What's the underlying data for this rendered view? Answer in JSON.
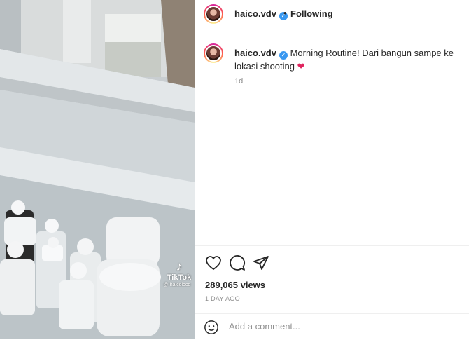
{
  "post": {
    "username": "haico.vdv",
    "follow_separator": "•",
    "follow_label": "Following",
    "caption": "Morning Routine! Dari bangun sampe ke lokasi shooting",
    "caption_time": "1d",
    "views": "289,065 views",
    "date": "1 DAY AGO",
    "comment_placeholder": "Add a comment..."
  },
  "video": {
    "watermark_brand": "TikTok",
    "watermark_handle": "@ haicoloco"
  },
  "colors": {
    "verified_blue": "#3897f0",
    "heart_red": "#e0245e",
    "muted_text": "#8e8e8e"
  }
}
